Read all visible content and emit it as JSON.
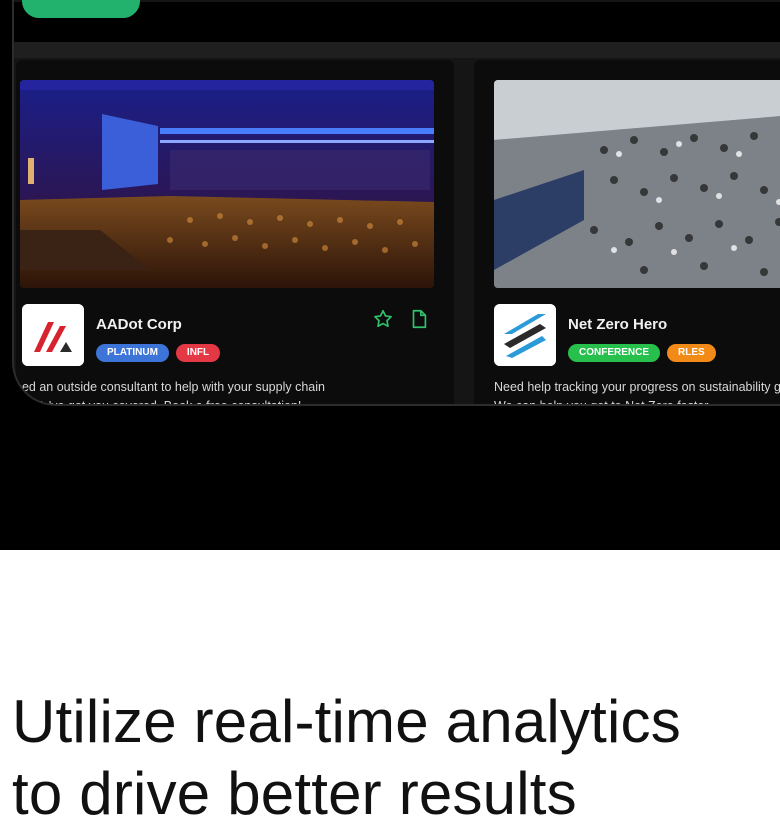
{
  "hero_button": {
    "label": ""
  },
  "cards": [
    {
      "name": "AADot Corp",
      "badges": [
        "PLATINUM",
        "INFL"
      ],
      "description": "Need an outside consultant to help with your supply chain",
      "description_line2": "... ? We've got you covered. Book a free consultation!",
      "logo_icon": "aadot-logo-icon"
    },
    {
      "name": "Net Zero Hero",
      "badges": [
        "CONFERENCE",
        "RLES"
      ],
      "description": "Need help tracking your progress on sustainability goals?",
      "description_line2": "We can help you get to Net Zero faster.",
      "logo_icon": "net-zero-hero-logo-icon"
    }
  ],
  "headline": {
    "line1": "Utilize real-time analytics",
    "line2": "to drive better results"
  },
  "colors": {
    "accent_green": "#22b26e",
    "badge_blue": "#3d74d8",
    "badge_red": "#e53845",
    "badge_green": "#27c04d",
    "badge_orange": "#f28a18"
  }
}
